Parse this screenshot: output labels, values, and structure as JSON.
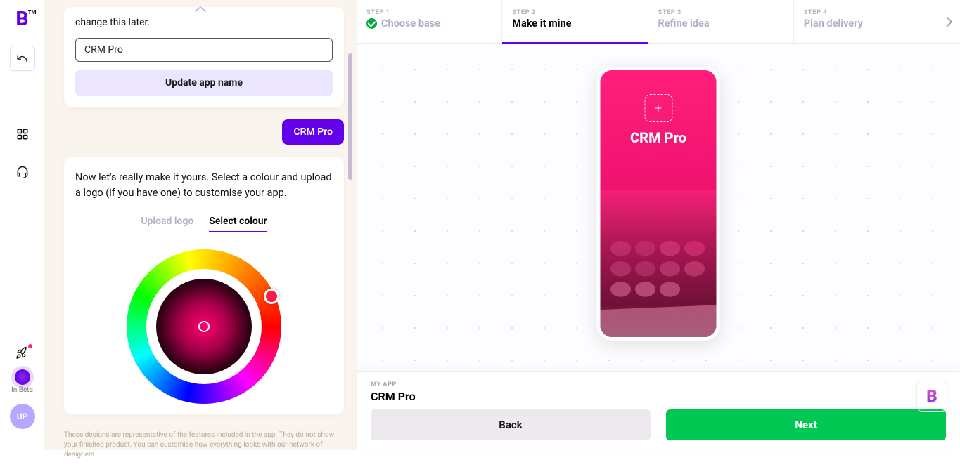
{
  "brand": {
    "letter": "B",
    "tm": "TM"
  },
  "rail": {
    "inBetaLabel": "In Beta",
    "avatarInitials": "UP"
  },
  "leftPanel": {
    "hintText": "change this later.",
    "appNameValue": "CRM Pro",
    "updateBtn": "Update app name",
    "userEcho": "CRM Pro",
    "customizeDesc": "Now let's really make it yours. Select a colour and upload a logo (if you have one) to customise your app.",
    "tabs": {
      "uploadLogo": "Upload logo",
      "selectColour": "Select colour"
    },
    "footnote": "These designs are representative of the features included in the app. They do not show your finished product. You can customise how everything looks with our network of designers."
  },
  "stepper": {
    "steps": [
      {
        "num": "STEP 1",
        "label": "Choose base",
        "state": "done"
      },
      {
        "num": "STEP 2",
        "label": "Make it mine",
        "state": "active"
      },
      {
        "num": "STEP 3",
        "label": "Refine idea",
        "state": "future"
      },
      {
        "num": "STEP 4",
        "label": "Plan delivery",
        "state": "future"
      }
    ]
  },
  "phone": {
    "title": "CRM Pro"
  },
  "footer": {
    "metaLabel": "MY APP",
    "metaValue": "CRM Pro",
    "backBtn": "Back",
    "nextBtn": "Next"
  },
  "colors": {
    "accent": "#6200ea",
    "selected": "#ff1a44",
    "next": "#00c853"
  }
}
